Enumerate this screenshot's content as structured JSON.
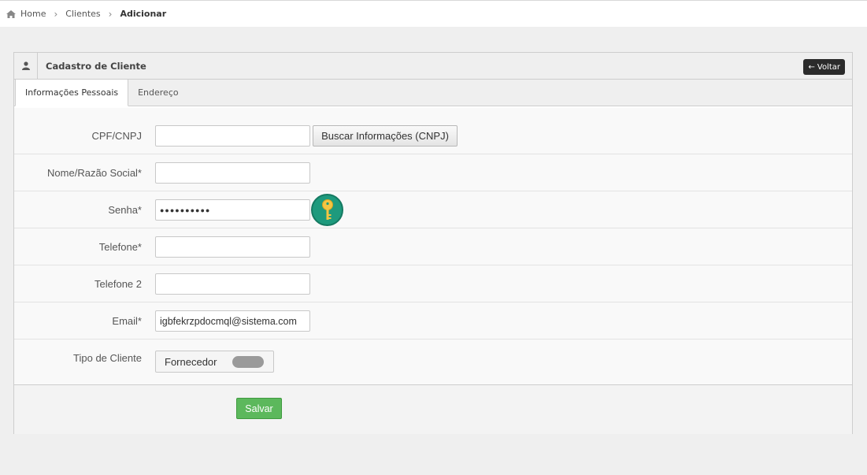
{
  "breadcrumb": {
    "home": "Home",
    "clientes": "Clientes",
    "current": "Adicionar"
  },
  "widget": {
    "title": "Cadastro de Cliente",
    "back_label": "Voltar"
  },
  "tabs": [
    {
      "label": "Informações Pessoais",
      "active": true
    },
    {
      "label": "Endereço",
      "active": false
    }
  ],
  "form": {
    "cpf": {
      "label": "CPF/CNPJ",
      "value": "",
      "button": "Buscar Informações (CNPJ)"
    },
    "nome": {
      "label": "Nome/Razão Social*",
      "value": ""
    },
    "senha": {
      "label": "Senha*",
      "value": "●●●●●●●●●●"
    },
    "telefone": {
      "label": "Telefone*",
      "value": ""
    },
    "telefone2": {
      "label": "Telefone 2",
      "value": ""
    },
    "email": {
      "label": "Email*",
      "value": "igbfekrzpdocmql@sistema.com"
    },
    "tipo": {
      "label": "Tipo de Cliente",
      "option": "Fornecedor"
    }
  },
  "save_label": "Salvar",
  "colors": {
    "save": "#5cb85c",
    "key_button": "#1e9a7d",
    "back_button": "#2b2b2b"
  }
}
